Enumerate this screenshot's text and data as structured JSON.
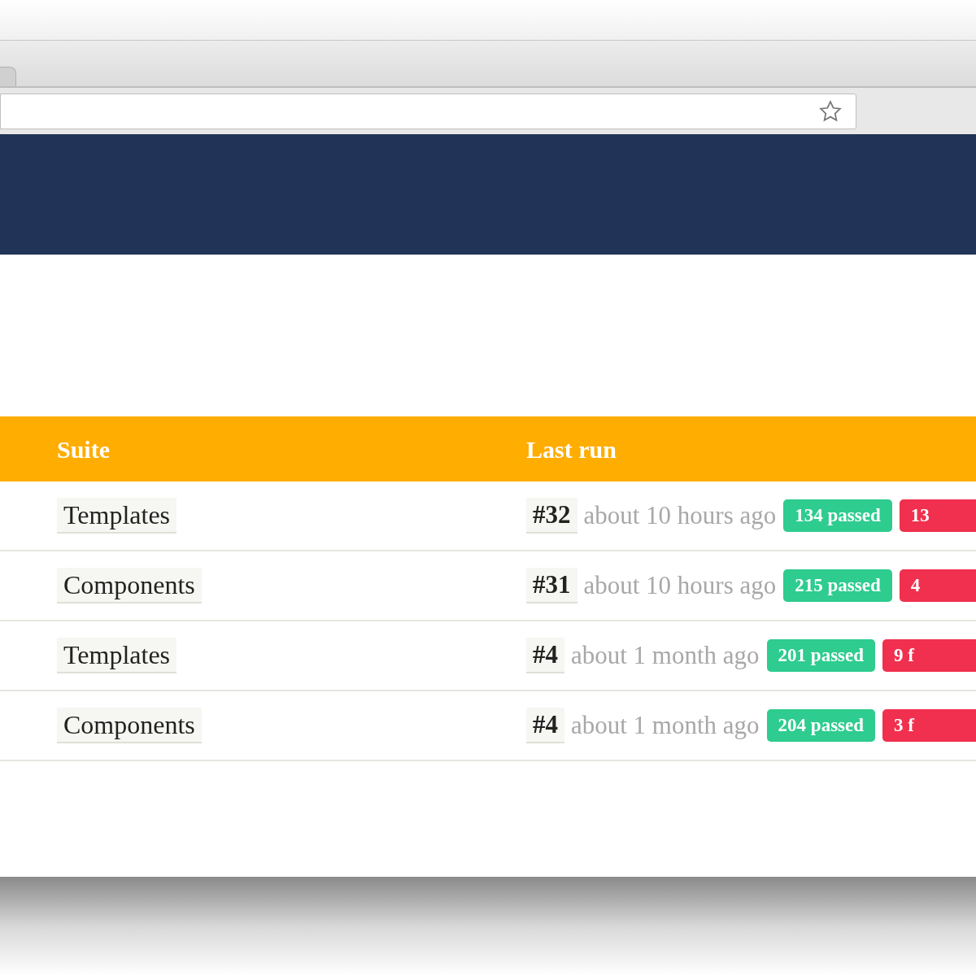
{
  "table": {
    "columns": [
      "Suite",
      "Last run"
    ],
    "rows": [
      {
        "suite": "Templates",
        "run": "#32",
        "time": "about 10 hours ago",
        "passed": "134 passed",
        "failed": "13"
      },
      {
        "suite": "Components",
        "run": "#31",
        "time": "about 10 hours ago",
        "passed": "215 passed",
        "failed": "4"
      },
      {
        "suite": "Templates",
        "run": "#4",
        "time": "about 1 month ago",
        "passed": "201 passed",
        "failed": "9 f"
      },
      {
        "suite": "Components",
        "run": "#4",
        "time": "about 1 month ago",
        "passed": "204 passed",
        "failed": "3 f"
      }
    ]
  }
}
